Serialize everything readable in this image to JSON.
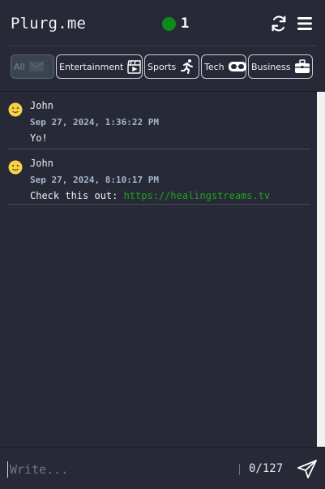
{
  "header": {
    "brand": "Plurg.me",
    "online_count": "1",
    "online_color": "#0e8a1b",
    "icons": [
      "refresh-icon",
      "menu-icon"
    ]
  },
  "tabs": [
    {
      "label": "All",
      "icon": "envelope-icon",
      "active": true
    },
    {
      "label": "Entertainment",
      "icon": "clapperboard-icon",
      "active": false
    },
    {
      "label": "Sports",
      "icon": "running-icon",
      "active": false
    },
    {
      "label": "Tech",
      "icon": "vr-headset-icon",
      "active": false
    },
    {
      "label": "Business",
      "icon": "briefcase-icon",
      "active": false
    }
  ],
  "messages": [
    {
      "avatar": "smiley-icon",
      "author": "John",
      "time": "Sep 27, 2024, 1:36:22 PM",
      "text": "Yo!"
    },
    {
      "avatar": "smiley-icon",
      "author": "John",
      "time": "Sep 27, 2024, 8:10:17 PM",
      "text": "Check this out: ",
      "link": "https://healingstreams.tv"
    }
  ],
  "composer": {
    "placeholder": "Write...",
    "value": "",
    "counter": "0/127",
    "send_icon": "send-icon"
  },
  "colors": {
    "background": "#272a36",
    "link": "#1fa31f",
    "timestamp": "#a7b3cc"
  }
}
